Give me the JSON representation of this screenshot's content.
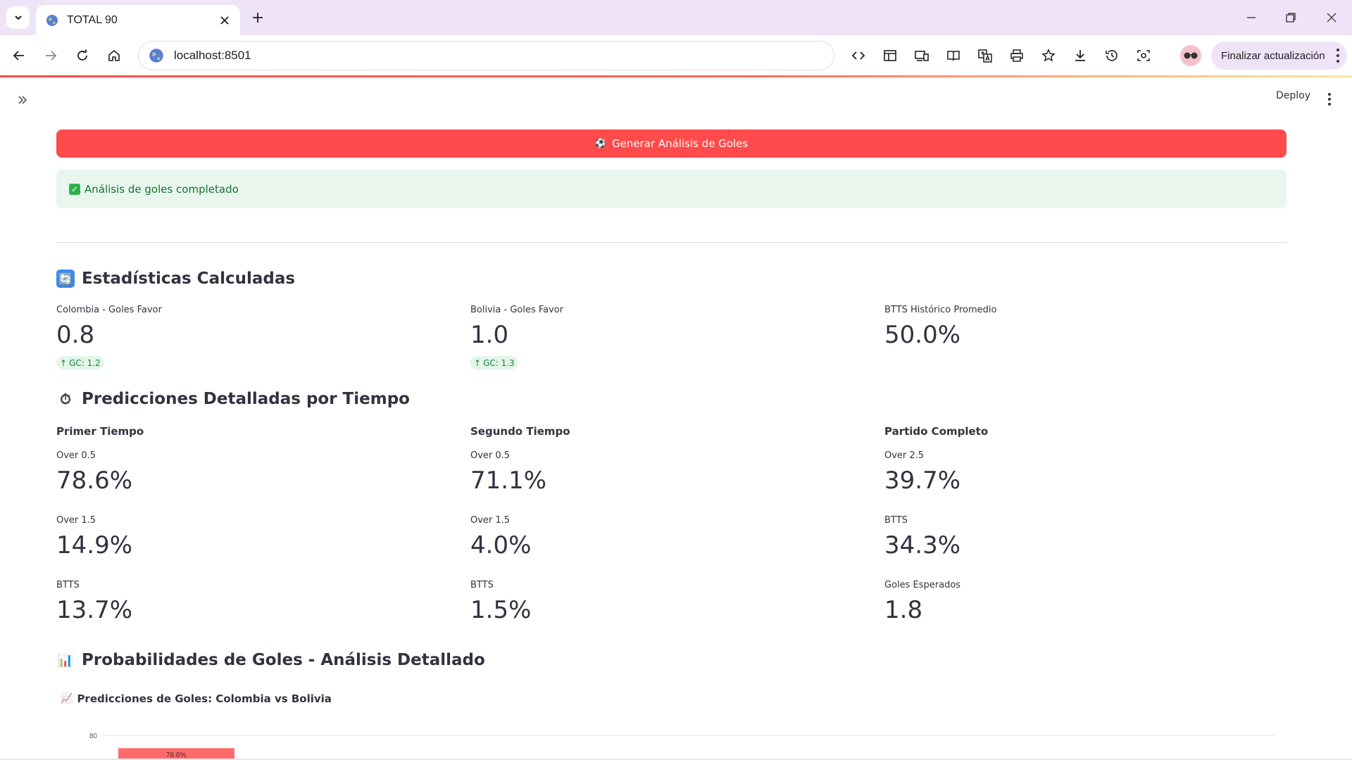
{
  "browser": {
    "tab_title": "TOTAL 90",
    "url": "localhost:8501",
    "update_button": "Finalizar actualización"
  },
  "app": {
    "deploy_label": "Deploy",
    "generate_button": {
      "emoji": "⚽",
      "label": "Generar Análisis de Goles"
    },
    "success_message": "Análisis de goles completado",
    "stats_section": {
      "icon": "🔄",
      "title": "Estadísticas Calculadas",
      "metrics": [
        {
          "label": "Colombia - Goles Favor",
          "value": "0.8",
          "delta": "GC: 1.2"
        },
        {
          "label": "Bolivia - Goles Favor",
          "value": "1.0",
          "delta": "GC: 1.3"
        },
        {
          "label": "BTTS Histórico Promedio",
          "value": "50.0%"
        }
      ]
    },
    "predictions_section": {
      "icon": "⏱",
      "title": "Predicciones Detalladas por Tiempo",
      "columns": [
        {
          "heading": "Primer Tiempo",
          "metrics": [
            {
              "label": "Over 0.5",
              "value": "78.6%"
            },
            {
              "label": "Over 1.5",
              "value": "14.9%"
            },
            {
              "label": "BTTS",
              "value": "13.7%"
            }
          ]
        },
        {
          "heading": "Segundo Tiempo",
          "metrics": [
            {
              "label": "Over 0.5",
              "value": "71.1%"
            },
            {
              "label": "Over 1.5",
              "value": "4.0%"
            },
            {
              "label": "BTTS",
              "value": "1.5%"
            }
          ]
        },
        {
          "heading": "Partido Completo",
          "metrics": [
            {
              "label": "Over 2.5",
              "value": "39.7%"
            },
            {
              "label": "BTTS",
              "value": "34.3%"
            },
            {
              "label": "Goles Esperados",
              "value": "1.8"
            }
          ]
        }
      ]
    },
    "probabilities_section": {
      "icon": "📊",
      "title": "Probabilidades de Goles - Análisis Detallado"
    }
  },
  "chart_data": {
    "type": "bar",
    "title": "Predicciones de Goles: Colombia vs Bolivia",
    "title_icon": "📈",
    "visible_ticks": [
      "80"
    ],
    "values": [
      78.6
    ],
    "data_labels": [
      "78.6%"
    ],
    "bar_color": "#ff6b6b",
    "grid": true
  }
}
